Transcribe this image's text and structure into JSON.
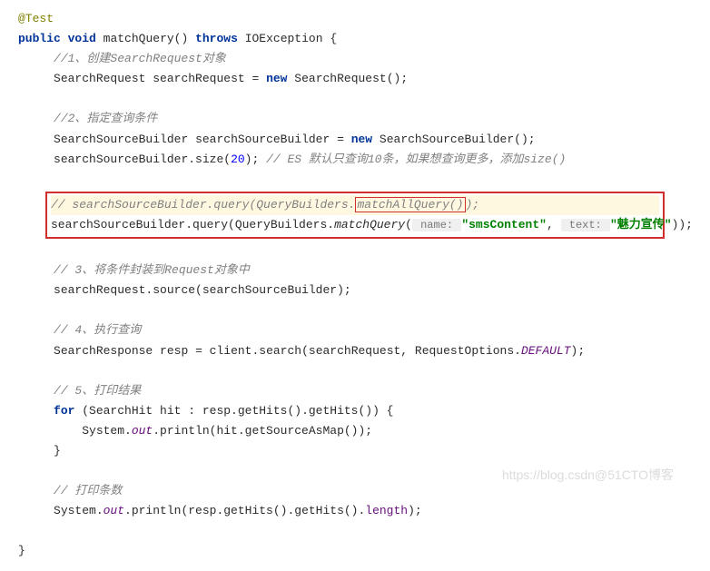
{
  "code": {
    "annotation": "@Test",
    "line2": {
      "public": "public",
      "void": "void",
      "method": "matchQuery",
      "throws": "throws",
      "exception": "IOException"
    },
    "comment1": "//1、创建SearchRequest对象",
    "line4": {
      "type": "SearchRequest",
      "var": "searchRequest",
      "newk": "new",
      "ctor": "SearchRequest"
    },
    "comment2": "//2、指定查询条件",
    "line7": {
      "type": "SearchSourceBuilder",
      "var": "searchSourceBuilder",
      "newk": "new",
      "ctor": "SearchSourceBuilder"
    },
    "line8": {
      "expr": "searchSourceBuilder.size(",
      "num": "20",
      "tail": ");",
      "comment": "// ES 默认只查询10条，如果想查询更多，添加size()"
    },
    "boxed": {
      "commented": {
        "pre": "// ",
        "mid": "searchSourceBuilder.query(QueryBuilders.",
        "boxed": "matchAllQuery()",
        "tail": ");"
      },
      "active": {
        "expr": "searchSourceBuilder.query(QueryBuilders.",
        "method": "matchQuery",
        "open": "(",
        "hint1": " name: ",
        "str1": "\"smsContent\"",
        "comma": ", ",
        "hint2": " text: ",
        "str2": "\"魅力宣传\"",
        "close": "));"
      }
    },
    "comment3": "// 3、将条件封装到Request对象中",
    "line11": "searchRequest.source(searchSourceBuilder);",
    "comment4": "// 4、执行查询",
    "line13": {
      "type": "SearchResponse",
      "var": "resp",
      "eq": " = client.search(searchRequest, RequestOptions.",
      "static": "DEFAULT",
      "tail": ");"
    },
    "comment5": "// 5、打印结果",
    "line15": {
      "for": "for",
      "open": " (SearchHit hit : resp.getHits().getHits()) {"
    },
    "line16": {
      "pre": "System.",
      "out": "out",
      "tail": ".println(hit.getSourceAsMap());"
    },
    "close1": "}",
    "comment6": "// 打印条数",
    "line18": {
      "pre": "System.",
      "out": "out",
      "mid": ".println(resp.getHits().getHits().",
      "len": "length",
      "tail": ");"
    },
    "close2": "}"
  },
  "watermark": "https://blog.csdn@51CTO博客"
}
